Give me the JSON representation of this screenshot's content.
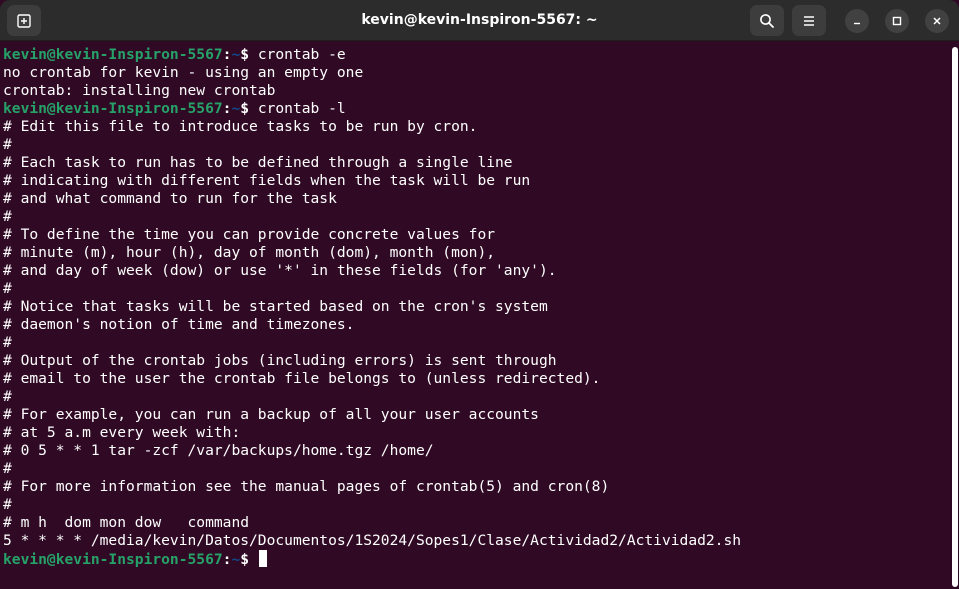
{
  "window": {
    "title": "kevin@kevin-Inspiron-5567: ~",
    "icons": {
      "new_tab": "new-tab-icon",
      "search": "search-icon",
      "menu": "hamburger-menu-icon",
      "minimize": "minimize-icon",
      "maximize": "maximize-icon",
      "close": "close-icon"
    }
  },
  "colors": {
    "background": "#300a24",
    "titlebar": "#2c2c2c",
    "prompt_user": "#26a269",
    "prompt_dir": "#12488b",
    "text": "#ffffff"
  },
  "prompt": {
    "user_host": "kevin@kevin-Inspiron-5567",
    "colon": ":",
    "dir": "~",
    "dollar": "$ "
  },
  "terminal": {
    "lines": [
      {
        "type": "cmd",
        "text": "crontab -e"
      },
      {
        "type": "out",
        "text": "no crontab for kevin - using an empty one"
      },
      {
        "type": "out",
        "text": "crontab: installing new crontab"
      },
      {
        "type": "cmd",
        "text": "crontab -l"
      },
      {
        "type": "out",
        "text": "# Edit this file to introduce tasks to be run by cron."
      },
      {
        "type": "out",
        "text": "#"
      },
      {
        "type": "out",
        "text": "# Each task to run has to be defined through a single line"
      },
      {
        "type": "out",
        "text": "# indicating with different fields when the task will be run"
      },
      {
        "type": "out",
        "text": "# and what command to run for the task"
      },
      {
        "type": "out",
        "text": "#"
      },
      {
        "type": "out",
        "text": "# To define the time you can provide concrete values for"
      },
      {
        "type": "out",
        "text": "# minute (m), hour (h), day of month (dom), month (mon),"
      },
      {
        "type": "out",
        "text": "# and day of week (dow) or use '*' in these fields (for 'any')."
      },
      {
        "type": "out",
        "text": "#"
      },
      {
        "type": "out",
        "text": "# Notice that tasks will be started based on the cron's system"
      },
      {
        "type": "out",
        "text": "# daemon's notion of time and timezones."
      },
      {
        "type": "out",
        "text": "#"
      },
      {
        "type": "out",
        "text": "# Output of the crontab jobs (including errors) is sent through"
      },
      {
        "type": "out",
        "text": "# email to the user the crontab file belongs to (unless redirected)."
      },
      {
        "type": "out",
        "text": "#"
      },
      {
        "type": "out",
        "text": "# For example, you can run a backup of all your user accounts"
      },
      {
        "type": "out",
        "text": "# at 5 a.m every week with:"
      },
      {
        "type": "out",
        "text": "# 0 5 * * 1 tar -zcf /var/backups/home.tgz /home/"
      },
      {
        "type": "out",
        "text": "#"
      },
      {
        "type": "out",
        "text": "# For more information see the manual pages of crontab(5) and cron(8)"
      },
      {
        "type": "out",
        "text": "#"
      },
      {
        "type": "out",
        "text": "# m h  dom mon dow   command"
      },
      {
        "type": "out",
        "text": "5 * * * * /media/kevin/Datos/Documentos/1S2024/Sopes1/Clase/Actividad2/Actividad2.sh"
      },
      {
        "type": "cmd",
        "text": ""
      }
    ]
  }
}
